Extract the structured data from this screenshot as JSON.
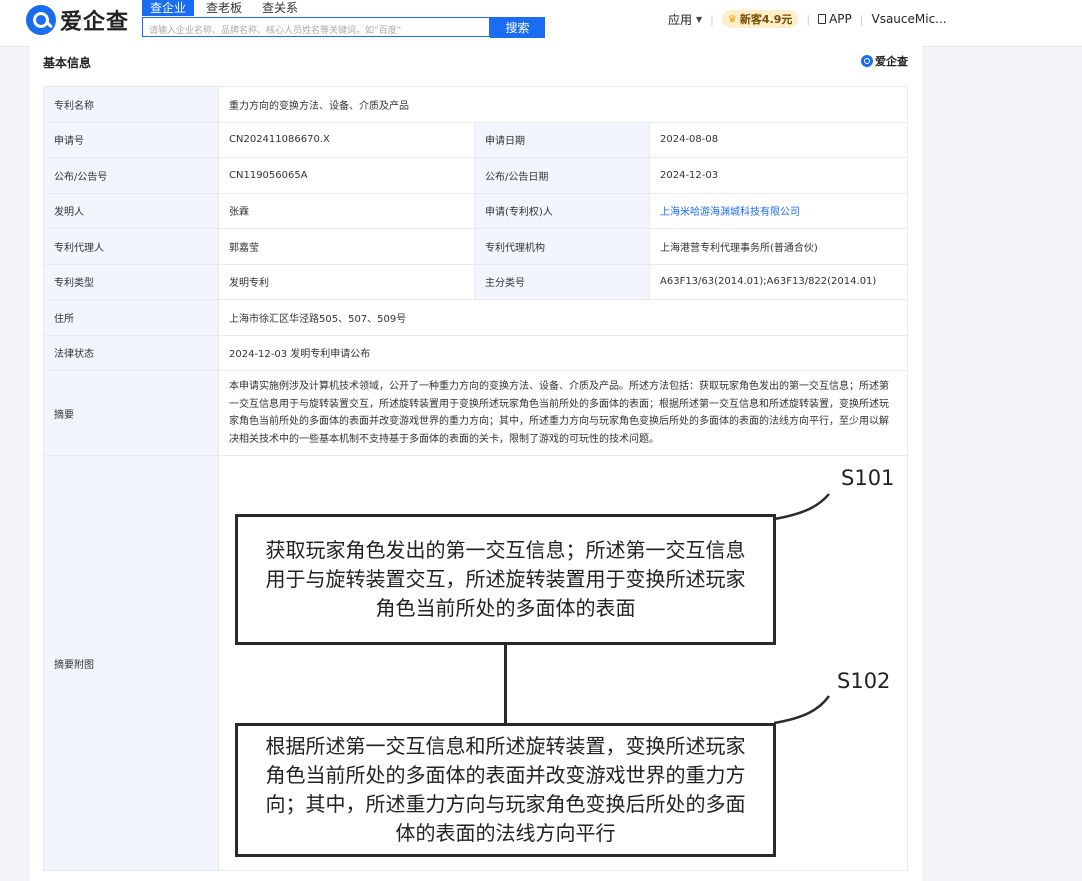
{
  "header": {
    "logo_text": "爱企查",
    "tabs": [
      "查企业",
      "查老板",
      "查关系"
    ],
    "search_placeholder": "请输入企业名称、品牌名称、核心人员姓名等关键词，如“百度”",
    "search_button": "搜索",
    "nav": {
      "app_menu": "应用",
      "promo": "新客4.9元",
      "app_link": "APP",
      "user": "VsauceMic..."
    }
  },
  "section": {
    "title": "基本信息",
    "brand": "爱企查"
  },
  "patent": {
    "name_label": "专利名称",
    "name": "重力方向的变换方法、设备、介质及产品",
    "app_no_label": "申请号",
    "app_no": "CN202411086670.X",
    "app_date_label": "申请日期",
    "app_date": "2024-08-08",
    "pub_no_label": "公布/公告号",
    "pub_no": "CN119056065A",
    "pub_date_label": "公布/公告日期",
    "pub_date": "2024-12-03",
    "inventor_label": "发明人",
    "inventor": "张霖",
    "applicant_label": "申请(专利权)人",
    "applicant": "上海米哈游海渊城科技有限公司",
    "agent_label": "专利代理人",
    "agent": "郭嘉莹",
    "agency_label": "专利代理机构",
    "agency": "上海港营专利代理事务所(普通合伙)",
    "type_label": "专利类型",
    "type": "发明专利",
    "main_class_label": "主分类号",
    "main_class": "A63F13/63(2014.01);A63F13/822(2014.01)",
    "address_label": "住所",
    "address": "上海市徐汇区华泾路505、507、509号",
    "legal_label": "法律状态",
    "legal": "2024-12-03 发明专利申请公布",
    "abstract_label": "摘要",
    "abstract": "本申请实施例涉及计算机技术领域，公开了一种重力方向的变换方法、设备、介质及产品。所述方法包括：获取玩家角色发出的第一交互信息；所述第一交互信息用于与旋转装置交互，所述旋转装置用于变换所述玩家角色当前所处的多面体的表面；根据所述第一交互信息和所述旋转装置，变换所述玩家角色当前所处的多面体的表面并改变游戏世界的重力方向；其中，所述重力方向与玩家角色变换后所处的多面体的表面的法线方向平行，至少用以解决相关技术中的一些基本机制不支持基于多面体的表面的关卡，限制了游戏的可玩性的技术问题。",
    "figure_label": "摘要附图"
  },
  "figure": {
    "step1_label": "S101",
    "step1_text": "获取玩家角色发出的第一交互信息；所述第一交互信息用于与旋转装置交互，所述旋转装置用于变换所述玩家角色当前所处的多面体的表面",
    "step2_label": "S102",
    "step2_text": "根据所述第一交互信息和所述旋转装置，变换所述玩家角色当前所处的多面体的表面并改变游戏世界的重力方向；其中，所述重力方向与玩家角色变换后所处的多面体的表面的法线方向平行"
  }
}
